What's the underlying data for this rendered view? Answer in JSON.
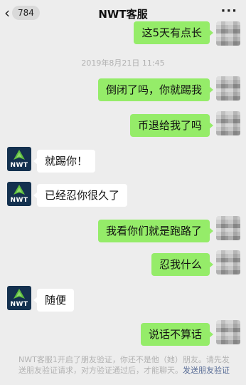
{
  "header": {
    "back_count": "784",
    "title": "NWT客服",
    "more": "···"
  },
  "timestamp": "2019年8月21日 11:45",
  "messages": {
    "m0": "这5天有点长",
    "m1": "倒闭了吗，你就踢我",
    "m2": "币退给我了吗",
    "m3": "就踢你！",
    "m4": "已经忍你很久了",
    "m5": "我看你们就是跑路了",
    "m6": "忍我什么",
    "m7": "随便",
    "m8": "说话不算话"
  },
  "bot_avatar_label": "NWT",
  "notice": {
    "text": "NWT客服1开启了朋友验证，你还不是他（她）朋友。请先发送朋友验证请求，对方验证通过后，才能聊天。",
    "link": "发送朋友验证"
  },
  "colors": {
    "outgoing_bubble": "#95ec69",
    "incoming_bubble": "#ffffff",
    "background": "#ededed",
    "link": "#576b95",
    "bot_avatar_bg": "#14314f",
    "bot_avatar_logo": "#5fbf3f"
  }
}
